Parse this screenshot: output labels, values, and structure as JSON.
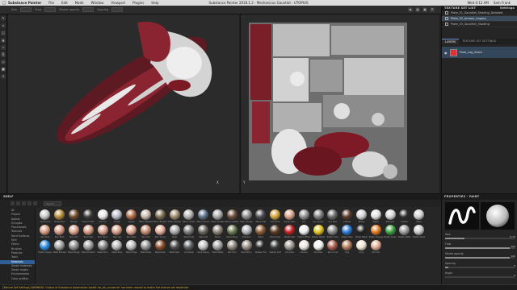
{
  "menubar": {
    "app_name": "Substance Painter",
    "items": [
      "File",
      "Edit",
      "Mode",
      "Window",
      "Viewport",
      "Plugins",
      "Help"
    ],
    "window_title": "Substance Painter 2018.1.2 - Mechanicus Gauntlet - UTOPIUS",
    "clock": [
      "Wed 4:12 AM",
      "Sam Frank"
    ]
  },
  "toolbar": {
    "fields": [
      "",
      "",
      "",
      ""
    ],
    "labels": [
      "Size",
      "Flow",
      "Stroke opacity",
      "Spacing"
    ]
  },
  "right_panel": {
    "texture_set_list_title": "TEXTURE SET LIST",
    "settings_label": "Settings",
    "texture_sets": [
      "Plate_01_Gauntlet_Shading_Detailed",
      "Plate_02_Armour_Legacy",
      "Plate_03_Gauntlet_Shading"
    ],
    "tabs": [
      "LAYERS",
      "TEXTURE SET SETTINGS"
    ],
    "layer_name": "Plate_Log_Seam"
  },
  "shelf": {
    "title": "SHELF",
    "search_placeholder": "Search",
    "categories": [
      "All",
      "Project",
      "Alphas",
      "Grunges",
      "Procedurals",
      "Textures",
      "Hard Surfaces",
      "Skin",
      "Filters",
      "Brushes",
      "Particles",
      "Tools",
      "Materials",
      "Smart materials",
      "Smart masks",
      "Environments",
      "Color profiles"
    ],
    "selected_category": "Materials",
    "materials": [
      {
        "name": "Aluminium",
        "color": "#c8c8c8"
      },
      {
        "name": "Brass Pure",
        "color": "#b48a3a"
      },
      {
        "name": "Bronze",
        "color": "#6e4a28"
      },
      {
        "name": "Carbon Fiber",
        "color": "#3a3a3a"
      },
      {
        "name": "Chrome",
        "color": "#e6e6e6"
      },
      {
        "name": "Cobalt",
        "color": "#b8bcc4"
      },
      {
        "name": "Copper",
        "color": "#b06a44"
      },
      {
        "name": "Fabric Baseball",
        "color": "#c4b8a8"
      },
      {
        "name": "Fabric Bamboo",
        "color": "#7a6a50"
      },
      {
        "name": "Fabric Burlap",
        "color": "#9c8a6a"
      },
      {
        "name": "Fabric Cotton",
        "color": "#b0b0b0"
      },
      {
        "name": "Fabric Denim",
        "color": "#5a6e88"
      },
      {
        "name": "Fabric Knitted",
        "color": "#a8a8a8"
      },
      {
        "name": "Fabric Leather",
        "color": "#6a4a3a"
      },
      {
        "name": "Fabric Rough",
        "color": "#8a8a8a"
      },
      {
        "name": "Fabric Suit",
        "color": "#4a4a52"
      },
      {
        "name": "Gold Pure",
        "color": "#d2a23a"
      },
      {
        "name": "Human Skin",
        "color": "#d8a088"
      },
      {
        "name": "Iron",
        "color": "#8e8e8e"
      },
      {
        "name": "Iron Grainy",
        "color": "#7c7c7c"
      },
      {
        "name": "Iron Raw",
        "color": "#6a6a6a"
      },
      {
        "name": "Leather",
        "color": "#5a3a2a"
      },
      {
        "name": "Nickel",
        "color": "#cfcfcf"
      },
      {
        "name": "Plastic",
        "color": "#e0e0e0"
      },
      {
        "name": "Platinum",
        "color": "#d6d6d6"
      },
      {
        "name": "Rubber",
        "color": "#2e2e2e"
      },
      {
        "name": "Silver",
        "color": "#d0d0d0"
      },
      {
        "name": "Skin Face",
        "color": "#d89a84"
      },
      {
        "name": "Skin Back",
        "color": "#d49882"
      },
      {
        "name": "Skin Arm",
        "color": "#dba28c"
      },
      {
        "name": "Skin Feet",
        "color": "#d2987e"
      },
      {
        "name": "Skin Hand",
        "color": "#d8a08a"
      },
      {
        "name": "Skin Leg",
        "color": "#d4a088"
      },
      {
        "name": "Skin Neck",
        "color": "#dca48e"
      },
      {
        "name": "Skin Old",
        "color": "#c48a72"
      },
      {
        "name": "Skin Young",
        "color": "#e4ae98"
      },
      {
        "name": "Steel",
        "color": "#a8a8a8"
      },
      {
        "name": "Steel Dirty",
        "color": "#7a7a7a"
      },
      {
        "name": "Steel Old",
        "color": "#6a665e"
      },
      {
        "name": "Stone",
        "color": "#8a8276"
      },
      {
        "name": "Stone Moss",
        "color": "#6a7a52"
      },
      {
        "name": "Titanium",
        "color": "#b0b4b8"
      },
      {
        "name": "Wood",
        "color": "#8a5a34"
      },
      {
        "name": "Wood Dark",
        "color": "#5a3a22"
      },
      {
        "name": "Plastic Red",
        "color": "#c02020"
      },
      {
        "name": "Plastic White",
        "color": "#eeeeee"
      },
      {
        "name": "Plastic Yellow",
        "color": "#e0c020"
      },
      {
        "name": "Plastic Gray",
        "color": "#8a8a8a"
      },
      {
        "name": "Plastic Blue",
        "color": "#2a7ad8"
      },
      {
        "name": "Plastic Black",
        "color": "#222222"
      },
      {
        "name": "Plastic Orange",
        "color": "#e07a20"
      },
      {
        "name": "Plastic Green",
        "color": "#3aa040"
      },
      {
        "name": "Plastic Matte",
        "color": "#9a9a9a"
      },
      {
        "name": "Plastic Gloss",
        "color": "#c8c8c8"
      },
      {
        "name": "Plastic Glossy Blue",
        "color": "#2a8ae0"
      },
      {
        "name": "Metal Painted",
        "color": "#a0a0a0"
      },
      {
        "name": "Metal Rough",
        "color": "#8e8e8e"
      },
      {
        "name": "Metal Scratched",
        "color": "#9c9c9c"
      },
      {
        "name": "Metal Worn",
        "color": "#868686"
      },
      {
        "name": "Metal Bare",
        "color": "#b4b4b4"
      },
      {
        "name": "Metal Edge",
        "color": "#bcbcbc"
      },
      {
        "name": "Metal Plate",
        "color": "#909090"
      },
      {
        "name": "Metal Rust",
        "color": "#8a4a2a"
      },
      {
        "name": "Metal Dark",
        "color": "#4a4a4a"
      },
      {
        "name": "Gunmetal",
        "color": "#5a5e62"
      },
      {
        "name": "Paint Glossy",
        "color": "#c0c0c0"
      },
      {
        "name": "Paint Matte",
        "color": "#a0a0a0"
      },
      {
        "name": "Paint Old",
        "color": "#8a847a"
      },
      {
        "name": "Paint Worn",
        "color": "#968e84"
      },
      {
        "name": "Rubber Tire",
        "color": "#2a2a2a"
      },
      {
        "name": "Rubber Soft",
        "color": "#3a3a3a"
      },
      {
        "name": "Concrete",
        "color": "#9a9690"
      },
      {
        "name": "Ceramic",
        "color": "#e8e4dc"
      },
      {
        "name": "Porcelain",
        "color": "#f0f0ee"
      },
      {
        "name": "Skin Crust",
        "color": "#a85a4a"
      },
      {
        "name": "Clay",
        "color": "#b07a5a"
      },
      {
        "name": "Ivory",
        "color": "#ece4d2"
      },
      {
        "name": "Skin Tan",
        "color": "#e0ac94"
      }
    ]
  },
  "properties": {
    "title": "PROPERTIES - PAINT",
    "rows": [
      {
        "label": "Size",
        "value": "5.74",
        "fill": 0.3
      },
      {
        "label": "Flow",
        "value": "100",
        "fill": 1.0
      },
      {
        "label": "Stroke opacity",
        "value": "100",
        "fill": 1.0
      },
      {
        "label": "Spacing",
        "value": "5",
        "fill": 0.05
      },
      {
        "label": "Angle",
        "value": "0",
        "fill": 0.0
      }
    ]
  },
  "status": {
    "message": "[Texture Set Settings] WARNING: Output of Substance Automation toolkit 'ao_bk_curvature' has been resized to match the texture set resolution"
  },
  "viewport": {
    "axis_3d": "X",
    "axis_2d": "Y"
  }
}
